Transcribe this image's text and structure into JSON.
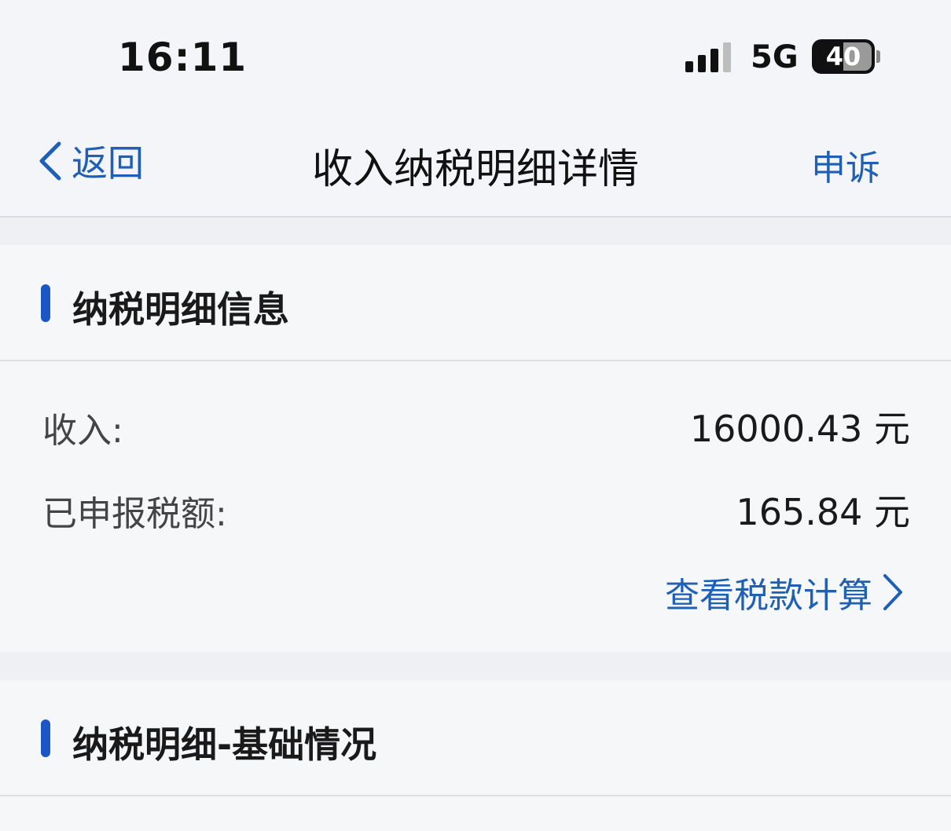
{
  "status_bar": {
    "time": "16:11",
    "network": "5G",
    "battery": "40"
  },
  "nav": {
    "back_label": "返回",
    "title": "收入纳税明细详情",
    "appeal_label": "申诉"
  },
  "tax_detail": {
    "section_title": "纳税明细信息",
    "rows": [
      {
        "label": "收入:",
        "value": "16000.43 元"
      },
      {
        "label": "已申报税额:",
        "value": "165.84 元"
      }
    ],
    "view_calc_label": "查看税款计算"
  },
  "basic_info": {
    "section_title": "纳税明细-基础情况"
  },
  "colors": {
    "accent": "#1f5fb5",
    "section_bar": "#1b57c4",
    "background": "#eef0f4"
  }
}
